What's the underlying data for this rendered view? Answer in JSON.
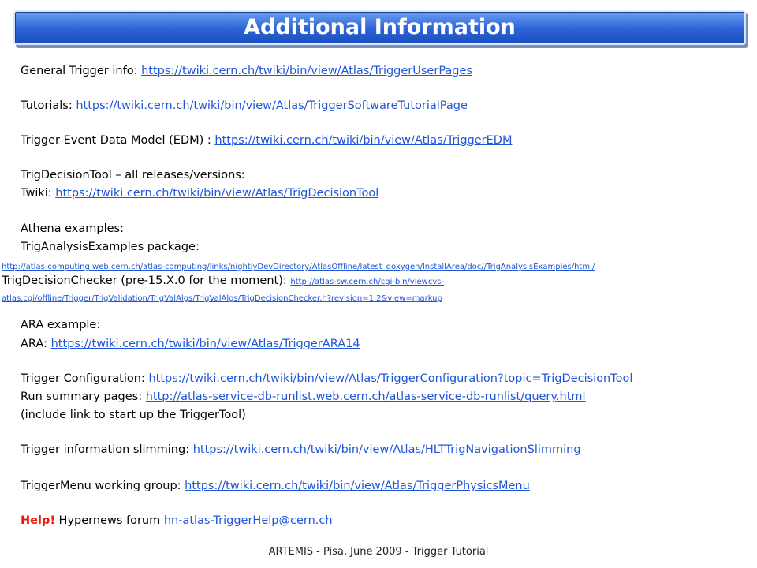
{
  "title": "Additional Information",
  "items": {
    "general": {
      "label": "General Trigger info: ",
      "url": "https://twiki.cern.ch/twiki/bin/view/Atlas/TriggerUserPages"
    },
    "tutorials": {
      "label": "Tutorials: ",
      "url": "https://twiki.cern.ch/twiki/bin/view/Atlas/TriggerSoftwareTutorialPage"
    },
    "edm": {
      "label": "Trigger Event Data Model (EDM) : ",
      "url": "https://twiki.cern.ch/twiki/bin/view/Atlas/TriggerEDM"
    },
    "tdt_heading": "TrigDecisionTool – all releases/versions:",
    "tdt": {
      "label": "Twiki: ",
      "url": "https://twiki.cern.ch/twiki/bin/view/Atlas/TrigDecisionTool"
    },
    "athena_heading": "Athena examples:",
    "analysis_heading": "TrigAnalysisExamples package:",
    "analysis_url": "http://atlas-computing.web.cern.ch/atlas-computing/links/nightlyDevDirectory/AtlasOffline/latest_doxygen/InstallArea/doc//TrigAnalysisExamples/html/",
    "checker": {
      "label": "TrigDecisionChecker (pre-15.X.0 for the moment): ",
      "url_part1": "http://atlas-sw.cern.ch/cgi-bin/viewcvs-",
      "url_part2": "atlas.cgi/offline/Trigger/TrigValidation/TrigValAlgs/TrigValAlgs/TrigDecisionChecker.h?revision=1.2&view=markup"
    },
    "ara_heading": "ARA example:",
    "ara": {
      "label": "ARA: ",
      "url": "https://twiki.cern.ch/twiki/bin/view/Atlas/TriggerARA14"
    },
    "config": {
      "label": "Trigger Configuration: ",
      "url": "https://twiki.cern.ch/twiki/bin/view/Atlas/TriggerConfiguration?topic=TrigDecisionTool"
    },
    "runsummary": {
      "label": "Run summary pages: ",
      "url": "http://atlas-service-db-runlist.web.cern.ch/atlas-service-db-runlist/query.html"
    },
    "runsummary_note": "(include link to start up the TriggerTool)",
    "slimming": {
      "label": "Trigger information slimming: ",
      "url": "https://twiki.cern.ch/twiki/bin/view/Atlas/HLTTrigNavigationSlimming"
    },
    "menu": {
      "label": "TriggerMenu working group: ",
      "url": "https://twiki.cern.ch/twiki/bin/view/Atlas/TriggerPhysicsMenu"
    },
    "help": {
      "prefix": "Help!",
      "label": " Hypernews forum ",
      "url": "hn-atlas-TriggerHelp@cern.ch"
    }
  },
  "footer": "ARTEMIS - Pisa, June 2009 - Trigger Tutorial",
  "colors": {
    "banner": "#2b63d6",
    "link": "#1f55d9",
    "help": "#e81a0c"
  }
}
